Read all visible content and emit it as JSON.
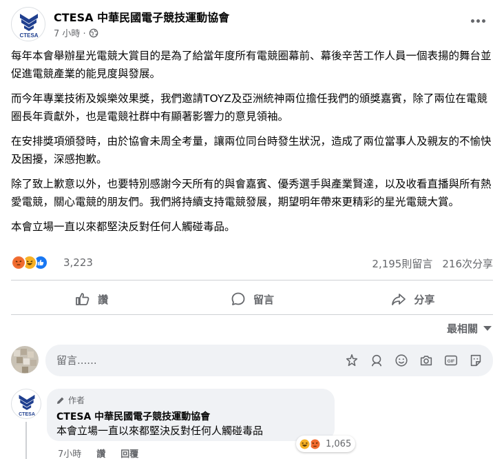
{
  "post": {
    "author": "CTESA 中華民國電子競技運動協會",
    "time": "7 小時 ·",
    "logo_text": "CTESA",
    "privacy_icon": "globe-icon",
    "paragraphs": [
      "每年本會舉辦星光電競大賞目的是為了給當年度所有電競圈幕前、幕後辛苦工作人員一個表揚的舞台並促進電競產業的能見度與發展。",
      "而今年專業技術及娛樂效果獎，我們邀請TOYZ及亞洲統神兩位擔任我們的頒獎嘉賓，除了兩位在電競圈長年貢獻外，也是電競社群中有顯著影響力的意見領袖。",
      "在安排獎項頒發時，由於協會未周全考量，讓兩位同台時發生狀況，造成了兩位當事人及親友的不愉快及困擾，深感抱歉。",
      "除了致上歉意以外，也要特別感謝今天所有的與會嘉賓、優秀選手與產業賢達，以及收看直播與所有熱愛電競，關心電競的朋友們。我們將持續支持電競發展，期望明年帶來更精彩的星光電競大賞。",
      "本會立場一直以來都堅決反對任何人觸碰毒品。"
    ]
  },
  "stats": {
    "reactions": "3,223",
    "comments": "2,195則留言",
    "shares": "216次分享",
    "reaction_icons": [
      "angry-icon",
      "haha-icon",
      "like-icon"
    ]
  },
  "actions": {
    "like": "讚",
    "comment": "留言",
    "share": "分享"
  },
  "sort_label": "最相關",
  "comment_input": {
    "placeholder": "留言......"
  },
  "top_comment": {
    "badge": "作者",
    "author": "CTESA 中華民國電子競技運動協會",
    "text": "本會立場一直以來都堅決反對任何人觸碰毒品",
    "reaction_count": "1,065",
    "time": "7小時",
    "like": "讚",
    "reply": "回覆",
    "logo_text": "CTESA"
  },
  "colors": {
    "primary_text": "#050505",
    "secondary_text": "#65676b",
    "like_blue": "#1877f2",
    "angry": "#e9710f",
    "haha": "#f7b125"
  }
}
